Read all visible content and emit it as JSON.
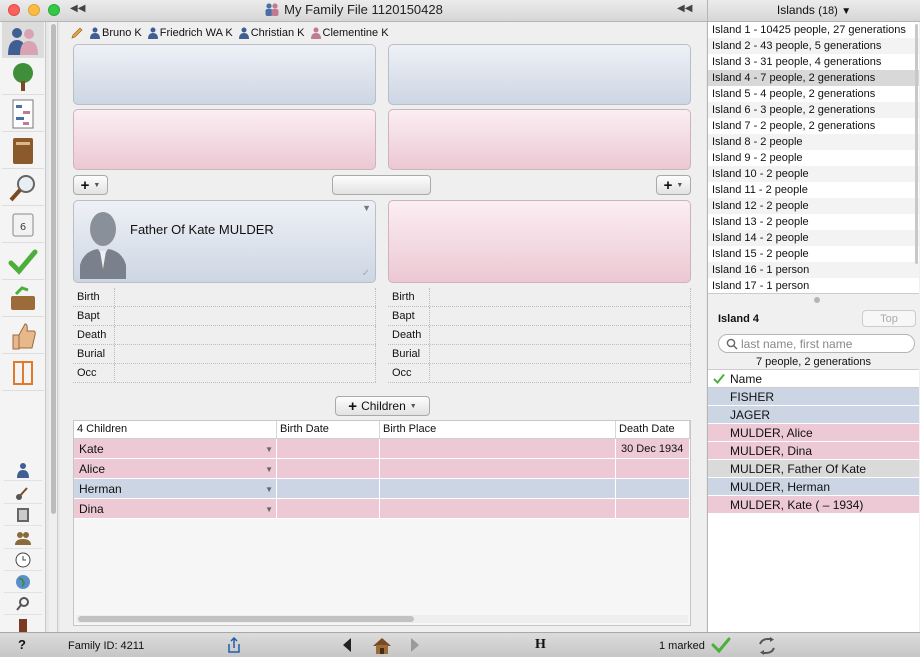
{
  "window": {
    "title": "My Family File 1120150428"
  },
  "breadcrumb": [
    {
      "name": "Bruno K",
      "sex": "male"
    },
    {
      "name": "Friedrich WA K",
      "sex": "male"
    },
    {
      "name": "Christian K",
      "sex": "male"
    },
    {
      "name": "Clementine K",
      "sex": "female"
    }
  ],
  "family": {
    "husband_name": "Father Of Kate MULDER",
    "children_button": "Children",
    "event_labels": [
      "Birth",
      "Bapt",
      "Death",
      "Burial",
      "Occ"
    ]
  },
  "children_table": {
    "headers": [
      "4 Children",
      "Birth Date",
      "Birth Place",
      "Death Date"
    ],
    "rows": [
      {
        "name": "Kate",
        "birth_date": "",
        "birth_place": "",
        "death_date": "30 Dec 1934",
        "sex": "female"
      },
      {
        "name": "Alice",
        "birth_date": "",
        "birth_place": "",
        "death_date": "",
        "sex": "female"
      },
      {
        "name": "Herman",
        "birth_date": "",
        "birth_place": "",
        "death_date": "",
        "sex": "male"
      },
      {
        "name": "Dina",
        "birth_date": "",
        "birth_place": "",
        "death_date": "",
        "sex": "female"
      }
    ]
  },
  "islands_panel": {
    "title": "Islands",
    "count": "(18)",
    "islands": [
      "Island 1 - 10425 people, 27 generations",
      "Island 2 - 43 people, 5 generations",
      "Island 3 - 31 people, 4 generations",
      "Island 4 - 7 people, 2 generations",
      "Island 5 - 4 people, 2 generations",
      "Island 6 - 3 people, 2 generations",
      "Island 7 - 2 people, 2 generations",
      "Island 8 - 2 people",
      "Island 9 - 2 people",
      "Island 10 - 2 people",
      "Island 11 - 2 people",
      "Island 12 - 2 people",
      "Island 13 - 2 people",
      "Island 14 - 2 people",
      "Island 15 - 2 people",
      "Island 16 - 1 person",
      "Island 17 - 1 person"
    ],
    "selected_island_index": 3,
    "selected_title": "Island 4",
    "top_button": "Top",
    "search_placeholder": "last name, first name",
    "summary": "7 people, 2 generations",
    "names_header": "Name",
    "names": [
      {
        "name": "FISHER",
        "sex": "male"
      },
      {
        "name": "JAGER",
        "sex": "male"
      },
      {
        "name": "MULDER, Alice",
        "sex": "female"
      },
      {
        "name": "MULDER, Dina",
        "sex": "female"
      },
      {
        "name": "MULDER, Father Of Kate",
        "sex": "selected"
      },
      {
        "name": "MULDER, Herman",
        "sex": "male"
      },
      {
        "name": "MULDER, Kate ( – 1934)",
        "sex": "female"
      }
    ]
  },
  "status_bar": {
    "help": "?",
    "family_id": "Family ID: 4211",
    "h_label": "H",
    "marked": "1 marked"
  },
  "colors": {
    "male": "#cbd5e4",
    "female": "#ecc9d4",
    "selected": "#dadada"
  }
}
